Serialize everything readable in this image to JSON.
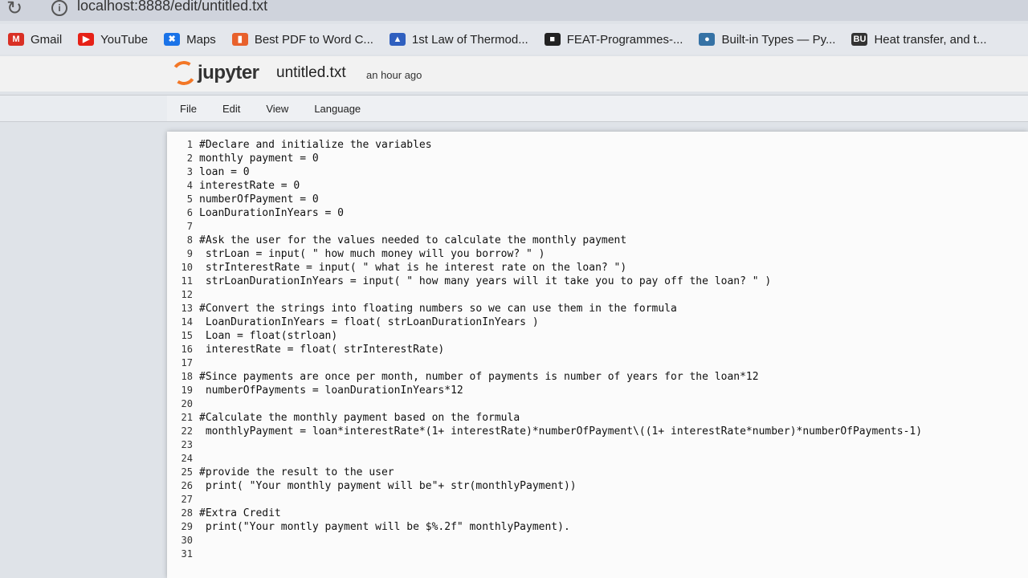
{
  "browser": {
    "url": "localhost:8888/edit/untitled.txt",
    "bookmarks": [
      {
        "label": "Gmail",
        "icon": "gmail-icon",
        "color": "#d93025",
        "glyph": "M"
      },
      {
        "label": "YouTube",
        "icon": "youtube-icon",
        "color": "#e62117",
        "glyph": "▶"
      },
      {
        "label": "Maps",
        "icon": "maps-icon",
        "color": "#1a73e8",
        "glyph": "✖"
      },
      {
        "label": "Best PDF to Word C...",
        "icon": "pdf-icon",
        "color": "#e8612c",
        "glyph": "▮"
      },
      {
        "label": "1st Law of Thermod...",
        "icon": "flask-icon",
        "color": "#2f5fbf",
        "glyph": "▲"
      },
      {
        "label": "FEAT-Programmes-...",
        "icon": "feat-icon",
        "color": "#222222",
        "glyph": "■"
      },
      {
        "label": "Built-in Types — Py...",
        "icon": "python-icon",
        "color": "#3572a5",
        "glyph": "●"
      },
      {
        "label": "Heat transfer, and t...",
        "icon": "bu-icon",
        "color": "#333333",
        "glyph": "BU"
      }
    ]
  },
  "jupyter": {
    "logo_text": "jupyter",
    "filename": "untitled.txt",
    "saved_status": "an hour ago",
    "menu": [
      "File",
      "Edit",
      "View",
      "Language"
    ]
  },
  "editor": {
    "lines": [
      "#Declare and initialize the variables",
      "monthly payment = 0",
      "loan = 0",
      "interestRate = 0",
      "numberOfPayment = 0",
      "LoanDurationInYears = 0",
      "",
      "#Ask the user for the values needed to calculate the monthly payment",
      " strLoan = input( \" how much money will you borrow? \" )",
      " strInterestRate = input( \" what is he interest rate on the loan? \")",
      " strLoanDurationInYears = input( \" how many years will it take you to pay off the loan? \" )",
      "",
      "#Convert the strings into floating numbers so we can use them in the formula",
      " LoanDurationInYears = float( strLoanDurationInYears )",
      " Loan = float(strloan)",
      " interestRate = float( strInterestRate)",
      "",
      "#Since payments are once per month, number of payments is number of years for the loan*12",
      " numberOfPayments = loanDurationInYears*12",
      "",
      "#Calculate the monthly payment based on the formula",
      " monthlyPayment = loan*interestRate*(1+ interestRate)*numberOfPayment\\((1+ interestRate*number)*numberOfPayments-1)",
      "",
      "",
      "#provide the result to the user",
      " print( \"Your monthly payment will be\"+ str(monthlyPayment))",
      "",
      "#Extra Credit",
      " print(\"Your montly payment will be $%.2f\" monthlyPayment).",
      "",
      ""
    ]
  }
}
